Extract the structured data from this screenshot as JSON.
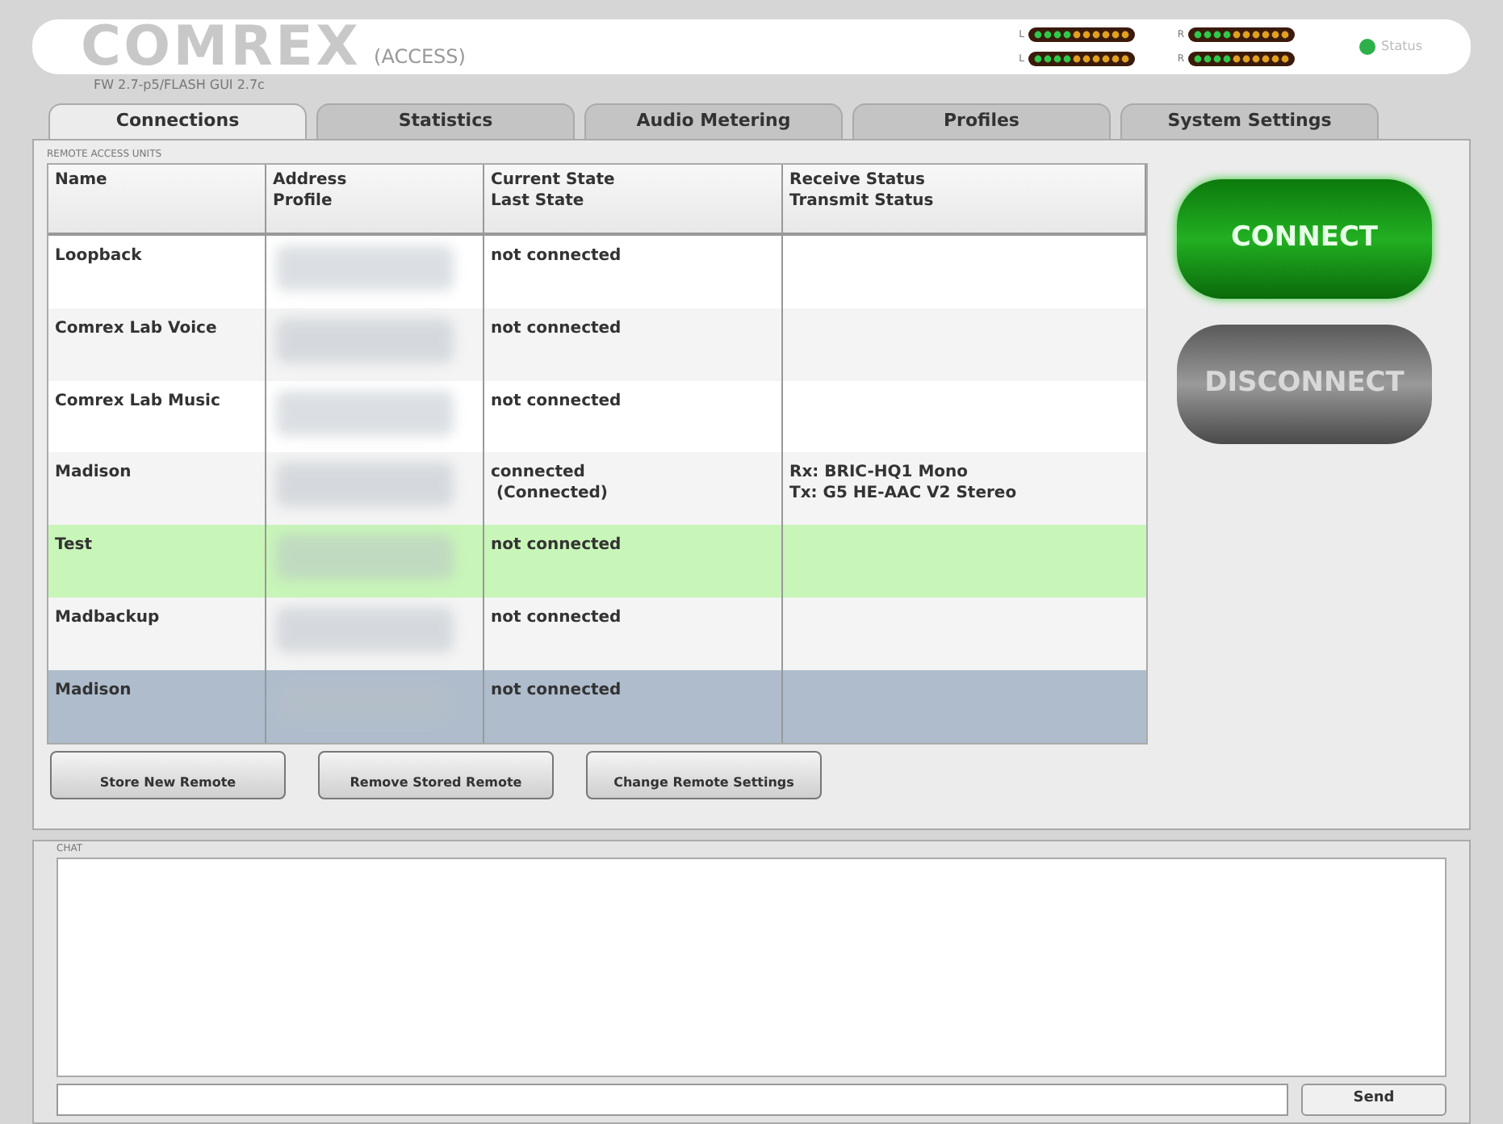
{
  "header": {
    "logo": "COMREX",
    "product": "(ACCESS)",
    "firmware": "FW 2.7-p5/FLASH GUI 2.7c",
    "meters": [
      {
        "label": "L"
      },
      {
        "label": "R"
      },
      {
        "label": "L"
      },
      {
        "label": "R"
      }
    ],
    "status": {
      "label": "Status",
      "on": true
    }
  },
  "tabs": [
    {
      "label": "Connections",
      "selected": true
    },
    {
      "label": "Statistics",
      "selected": false
    },
    {
      "label": "Audio Metering",
      "selected": false
    },
    {
      "label": "Profiles",
      "selected": false
    },
    {
      "label": "System Settings",
      "selected": false
    }
  ],
  "section_label": "REMOTE ACCESS UNITS",
  "table": {
    "columns": [
      [
        "Name"
      ],
      [
        "Address",
        "Profile"
      ],
      [
        "Current State",
        "Last State"
      ],
      [
        "Receive Status",
        "Transmit Status"
      ]
    ],
    "rows": [
      {
        "name": "Loopback",
        "state": [
          "not connected"
        ],
        "status": [],
        "selected": false,
        "active": false
      },
      {
        "name": "Comrex Lab Voice",
        "state": [
          "not connected"
        ],
        "status": [],
        "selected": false,
        "active": false
      },
      {
        "name": "Comrex Lab Music",
        "state": [
          "not connected"
        ],
        "status": [],
        "selected": false,
        "active": false
      },
      {
        "name": "Madison",
        "state": [
          "connected",
          " (Connected)"
        ],
        "status": [
          "Rx: BRIC-HQ1 Mono",
          "Tx: G5 HE-AAC V2 Stereo"
        ],
        "selected": false,
        "active": false
      },
      {
        "name": "Test",
        "state": [
          "not connected"
        ],
        "status": [],
        "selected": false,
        "active": true
      },
      {
        "name": "Madbackup",
        "state": [
          "not connected"
        ],
        "status": [],
        "selected": false,
        "active": false
      },
      {
        "name": "Madison",
        "state": [
          "not connected"
        ],
        "status": [],
        "selected": true,
        "active": false
      }
    ]
  },
  "row_buttons": [
    "Store New Remote",
    "Remove Stored Remote",
    "Change Remote Settings"
  ],
  "connect": {
    "label": "CONNECT",
    "disabled": false
  },
  "disconnect": {
    "label": "DISCONNECT",
    "disabled": true
  },
  "chat": {
    "label": "CHAT",
    "send": "Send"
  }
}
